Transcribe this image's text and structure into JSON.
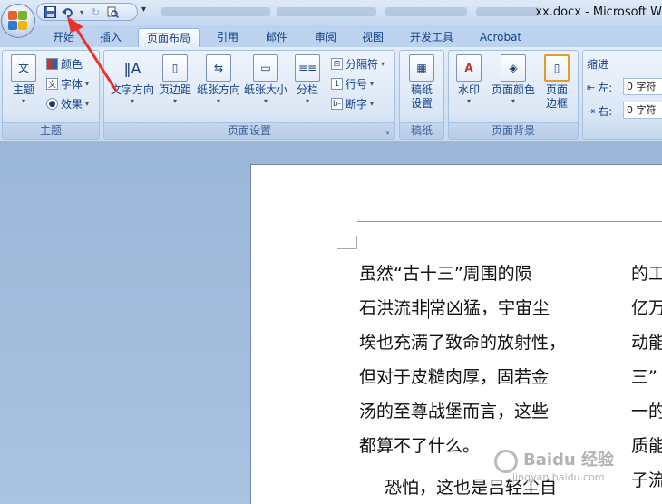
{
  "window": {
    "title": "xx.docx - Microsoft W"
  },
  "quick_access": {
    "save_icon": "save-icon",
    "undo_icon": "undo-icon",
    "redo_icon": "redo-icon",
    "print_preview_icon": "print-preview-icon",
    "more_label": "▾"
  },
  "tabs": [
    {
      "label": "开始"
    },
    {
      "label": "插入"
    },
    {
      "label": "页面布局"
    },
    {
      "label": "引用"
    },
    {
      "label": "邮件"
    },
    {
      "label": "审阅"
    },
    {
      "label": "视图"
    },
    {
      "label": "开发工具"
    },
    {
      "label": "Acrobat"
    }
  ],
  "active_tab": "页面布局",
  "ribbon": {
    "theme_group": {
      "label": "主题",
      "theme_button": "主题",
      "colors": "颜色",
      "fonts": "字体",
      "effects": "效果"
    },
    "page_setup_group": {
      "label": "页面设置",
      "text_direction": "文字方向",
      "margins": "页边距",
      "orientation": "纸张方向",
      "size": "纸张大小",
      "columns": "分栏",
      "breaks": "分隔符",
      "line_numbers": "行号",
      "hyphenation": "断字"
    },
    "manuscript_group": {
      "label": "稿纸",
      "manuscript_settings_line1": "稿纸",
      "manuscript_settings_line2": "设置"
    },
    "page_background_group": {
      "label": "页面背景",
      "watermark": "水印",
      "page_color": "页面颜色",
      "page_borders_line1": "页面",
      "page_borders_line2": "边框"
    },
    "paragraph_group": {
      "indent_label": "缩进",
      "left_label": "左:",
      "left_value": "0 字符",
      "right_label": "右:",
      "right_value": "0 字符"
    }
  },
  "document": {
    "column1": [
      "虽然“古十三”周围的陨",
      "石洪流非",
      "常凶猛，宇宙尘",
      "埃也充满了致命的放射性，",
      "但对于皮糙肉厚，固若金",
      "汤的至尊战堡而言，这些",
      "都算不了什么。",
      "恐怕，这也是吕轻尘自"
    ],
    "column2": [
      "的工",
      "亿万",
      "动能",
      "三”",
      "一的",
      "质能",
      "子流"
    ]
  },
  "watermark": {
    "text": "Baidu 经验",
    "url": "jingyan.baidu.com"
  },
  "colors": {
    "accent": "#15428b",
    "ribbon": "#dbe7f6",
    "annotation_arrow": "#e8322b"
  }
}
